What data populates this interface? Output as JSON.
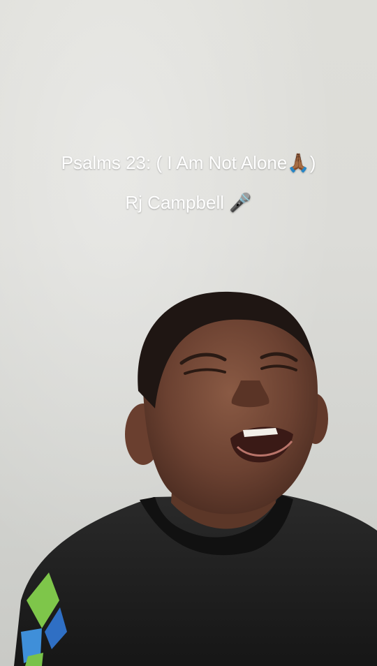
{
  "video": {
    "caption_title": "Psalms 23: ( I Am Not Alone",
    "caption_title_emoji": "🙏🏾",
    "caption_title_end": ")",
    "caption_artist": "Rj Campbell",
    "caption_artist_emoji": "🎤"
  },
  "icons": {
    "praying_hands": "praying-hands-icon",
    "microphone": "microphone-icon"
  }
}
